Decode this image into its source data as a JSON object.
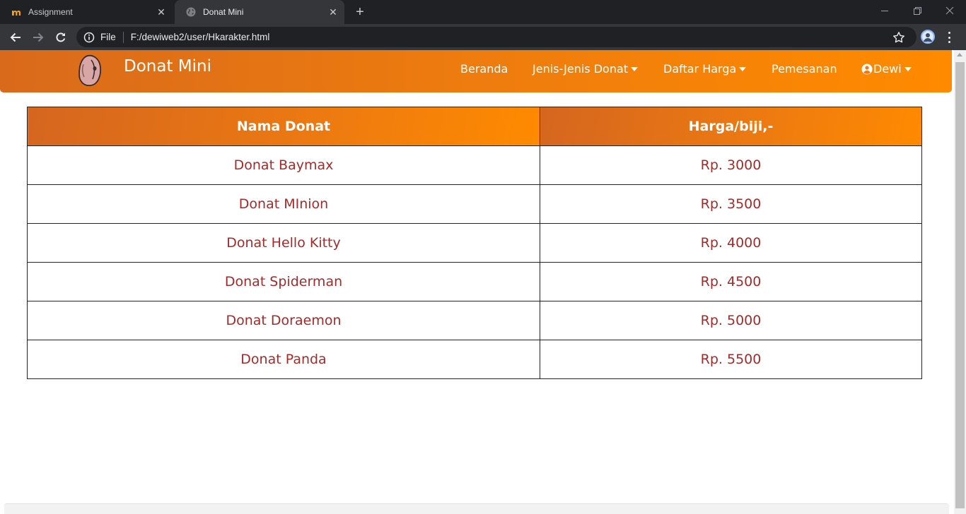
{
  "browser": {
    "tabs": [
      {
        "title": "Assignment",
        "icon": "brand-m-icon",
        "active": false
      },
      {
        "title": "Donat Mini",
        "icon": "globe-icon",
        "active": true
      }
    ],
    "address": {
      "scheme_label": "File",
      "url": "F:/dewiweb2/user/Hkarakter.html"
    }
  },
  "navbar": {
    "brand": "Donat Mini",
    "items": [
      {
        "label": "Beranda",
        "dropdown": false
      },
      {
        "label": "Jenis-Jenis Donat",
        "dropdown": true
      },
      {
        "label": "Daftar Harga",
        "dropdown": true
      },
      {
        "label": "Pemesanan",
        "dropdown": false
      }
    ],
    "user": {
      "label": "Dewi",
      "icon": "user-circle-icon",
      "dropdown": true
    }
  },
  "table": {
    "headers": [
      "Nama Donat",
      "Harga/biji,-"
    ],
    "rows": [
      {
        "name": "Donat Baymax",
        "price": "Rp. 3000"
      },
      {
        "name": "Donat MInion",
        "price": "Rp. 3500"
      },
      {
        "name": "Donat Hello Kitty",
        "price": "Rp. 4000"
      },
      {
        "name": "Donat Spiderman",
        "price": "Rp. 4500"
      },
      {
        "name": "Donat Doraemon",
        "price": "Rp. 5000"
      },
      {
        "name": "Donat Panda",
        "price": "Rp. 5500"
      }
    ]
  },
  "colors": {
    "accent_start": "#d96a1b",
    "accent_end": "#ff8a00",
    "cell_text": "#a52a2a"
  }
}
